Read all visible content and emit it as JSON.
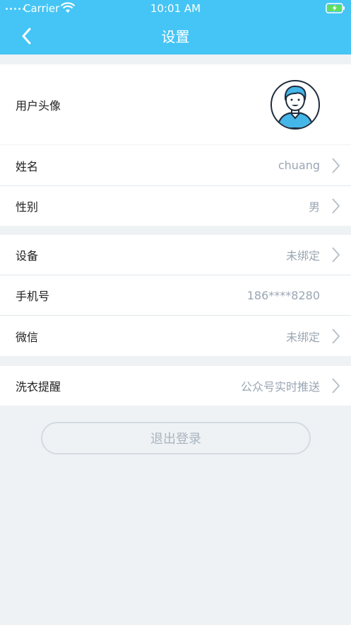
{
  "status_bar": {
    "carrier": "Carrier",
    "time": "10:01 AM"
  },
  "nav": {
    "title": "设置"
  },
  "profile": {
    "avatar_label": "用户头像"
  },
  "group1": {
    "name_label": "姓名",
    "name_value": "chuang",
    "gender_label": "性别",
    "gender_value": "男"
  },
  "group2": {
    "device_label": "设备",
    "device_value": "未绑定",
    "phone_label": "手机号",
    "phone_value": "186****8280",
    "wechat_label": "微信",
    "wechat_value": "未绑定"
  },
  "group3": {
    "reminder_label": "洗衣提醒",
    "reminder_value": "公众号实时推送"
  },
  "logout": {
    "label": "退出登录"
  },
  "colors": {
    "header": "#45c5f5",
    "avatar_accent": "#45b6e8",
    "background": "#eef2f5"
  }
}
